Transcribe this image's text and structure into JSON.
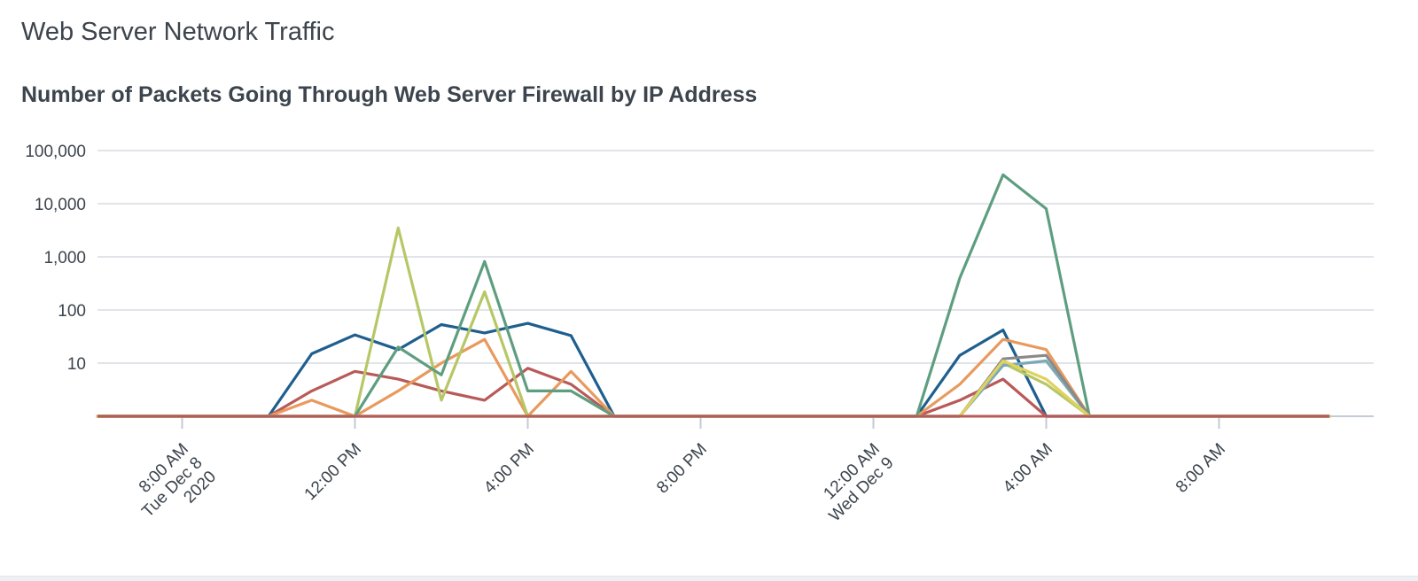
{
  "panel": {
    "title": "Web Server Network Traffic"
  },
  "chart_data": {
    "type": "line",
    "title": "Number of Packets Going Through Web Server Firewall by IP Address",
    "xlabel": "",
    "ylabel": "",
    "y_scale": "log",
    "ylim": [
      1,
      200000
    ],
    "y_ticks": [
      {
        "value": 10,
        "label": "10"
      },
      {
        "value": 100,
        "label": "100"
      },
      {
        "value": 1000,
        "label": "1,000"
      },
      {
        "value": 10000,
        "label": "10,000"
      },
      {
        "value": 100000,
        "label": "100,000"
      }
    ],
    "xlim": [
      "2020-12-08 06:00",
      "2020-12-09 12:00"
    ],
    "x_ticks": [
      {
        "value": "2020-12-08 08:00",
        "label": [
          "8:00 AM",
          "Tue Dec 8",
          "2020"
        ]
      },
      {
        "value": "2020-12-08 12:00",
        "label": [
          "12:00 PM"
        ]
      },
      {
        "value": "2020-12-08 16:00",
        "label": [
          "4:00 PM"
        ]
      },
      {
        "value": "2020-12-08 20:00",
        "label": [
          "8:00 PM"
        ]
      },
      {
        "value": "2020-12-09 00:00",
        "label": [
          "12:00 AM",
          "Wed Dec 9"
        ]
      },
      {
        "value": "2020-12-09 04:00",
        "label": [
          "4:00 AM"
        ]
      },
      {
        "value": "2020-12-09 08:00",
        "label": [
          "8:00 AM"
        ]
      }
    ],
    "grid": true,
    "legend": "none",
    "x": [
      "2020-12-08 10:00",
      "2020-12-08 11:00",
      "2020-12-08 12:00",
      "2020-12-08 13:00",
      "2020-12-08 14:00",
      "2020-12-08 15:00",
      "2020-12-08 16:00",
      "2020-12-08 17:00",
      "2020-12-08 18:00",
      "2020-12-09 01:00",
      "2020-12-09 02:00",
      "2020-12-09 03:00",
      "2020-12-09 04:00",
      "2020-12-09 05:00"
    ],
    "series": [
      {
        "color": "#1e5f8f",
        "values": [
          1,
          15,
          34,
          18,
          53,
          37,
          56,
          33,
          1,
          1,
          14,
          42,
          1,
          1
        ]
      },
      {
        "color": "#b85a58",
        "values": [
          1,
          3,
          7,
          5,
          3,
          2,
          8,
          4,
          1,
          1,
          2,
          5,
          1,
          1
        ]
      },
      {
        "color": "#e89a5e",
        "values": [
          1,
          2,
          1,
          3,
          10,
          28,
          1,
          7,
          1,
          1,
          4,
          28,
          18,
          1
        ]
      },
      {
        "color": "#b6c766",
        "values": [
          1,
          1,
          1,
          3500,
          2,
          220,
          1,
          1,
          1,
          1,
          1,
          10,
          4,
          1
        ]
      },
      {
        "color": "#5e9e80",
        "values": [
          1,
          1,
          1,
          20,
          6,
          820,
          3,
          3,
          1,
          1,
          400,
          35000,
          8000,
          1
        ]
      },
      {
        "color": "#7aa9b8",
        "values": [
          1,
          1,
          1,
          1,
          1,
          1,
          1,
          1,
          1,
          1,
          1,
          9,
          11,
          1
        ]
      },
      {
        "color": "#8a8a8a",
        "values": [
          1,
          1,
          1,
          1,
          1,
          1,
          1,
          1,
          1,
          1,
          1,
          12,
          14,
          1
        ]
      },
      {
        "color": "#e0d25e",
        "values": [
          1,
          1,
          1,
          1,
          1,
          1,
          1,
          1,
          1,
          1,
          1,
          11,
          5,
          1
        ]
      }
    ]
  },
  "colors": {
    "grid": "#e1e4e8",
    "axis": "#c3cbd4",
    "text": "#3c444d"
  }
}
